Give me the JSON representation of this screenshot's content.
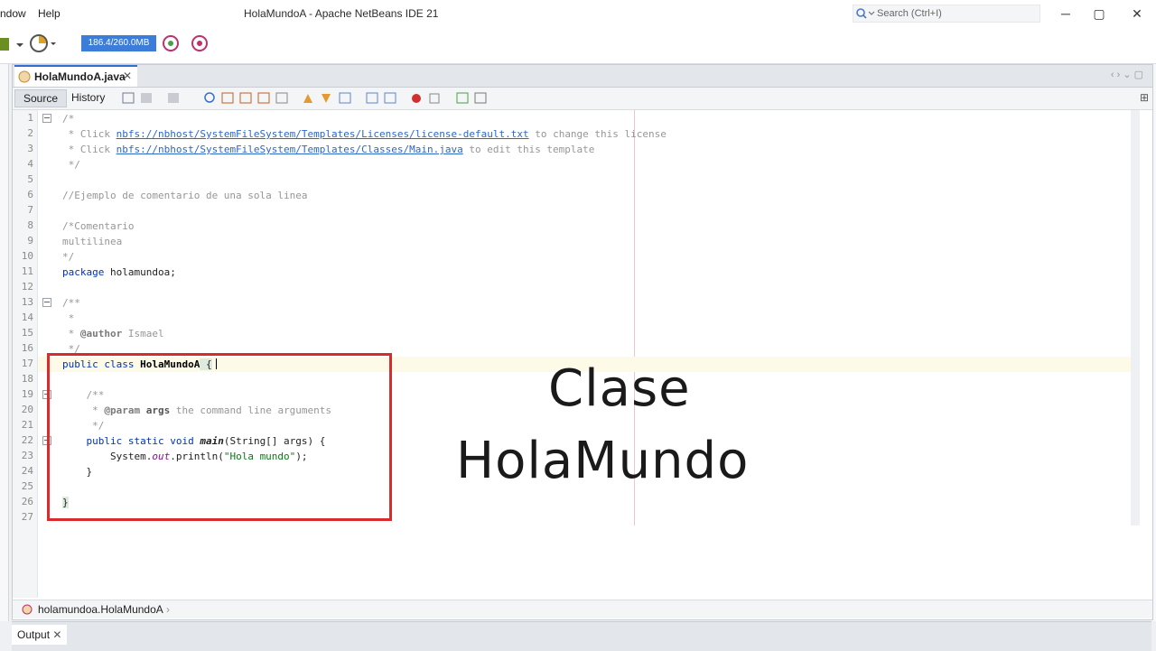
{
  "menubar": {
    "menus": [
      "ndow",
      "Help"
    ]
  },
  "window": {
    "title": "HolaMundoA - Apache NetBeans IDE 21",
    "search_placeholder": "Search (Ctrl+I)",
    "minimize": "─",
    "maximize": "▢",
    "close": "✕"
  },
  "toolbar": {
    "memory": "186.4/260.0MB"
  },
  "editor": {
    "tab_name": "HolaMundoA.java",
    "tab_close": "✕",
    "view_tabs": [
      "Source",
      "History"
    ],
    "breadcrumb": "holamundoa.HolaMundoA"
  },
  "code": {
    "line_numbers": [
      "1",
      "2",
      "3",
      "4",
      "5",
      "6",
      "7",
      "8",
      "9",
      "10",
      "11",
      "12",
      "13",
      "14",
      "15",
      "16",
      "17",
      "18",
      "19",
      "20",
      "21",
      "22",
      "23",
      "24",
      "25",
      "26",
      "27"
    ],
    "l1": "/*",
    "l2a": " * Click ",
    "l2b": "nbfs://nbhost/SystemFileSystem/Templates/Licenses/license-default.txt",
    "l2c": " to change this license",
    "l3a": " * Click ",
    "l3b": "nbfs://nbhost/SystemFileSystem/Templates/Classes/Main.java",
    "l3c": " to edit this template",
    "l4": " */",
    "l6": "//Ejemplo de comentario de una sola linea",
    "l8": "/*Comentario",
    "l9": "multilinea",
    "l10": "*/",
    "l11a": "package",
    "l11b": " holamundoa;",
    "l13": "/**",
    "l14": " *",
    "l15a": " * ",
    "l15b": "@author",
    "l15c": " Ismael",
    "l16": " */",
    "l17a": "public class ",
    "l17b": "HolaMundoA",
    "l17c": " {",
    "l19": "    /**",
    "l20a": "     * ",
    "l20b": "@param",
    "l20c": " args",
    "l20d": " the command line arguments",
    "l21": "     */",
    "l22a": "    public static void ",
    "l22b": "main",
    "l22c": "(String[] args) {",
    "l23a": "        System.",
    "l23b": "out",
    "l23c": ".println(",
    "l23d": "\"Hola mundo\"",
    "l23e": ");",
    "l24": "    }",
    "l26": "}"
  },
  "overlay": {
    "line1": "Clase",
    "line2": "HolaMundo"
  },
  "bottom": {
    "output_tab": "Output",
    "output_close": "✕"
  }
}
